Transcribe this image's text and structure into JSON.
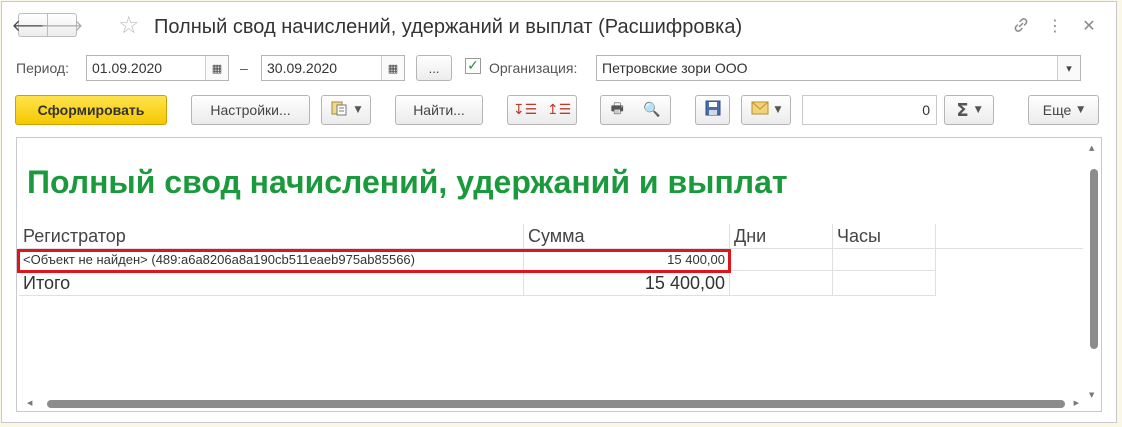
{
  "window": {
    "title": "Полный свод начислений, удержаний и выплат (Расшифровка)",
    "icons": {
      "back": "arrow-left-icon",
      "forward": "arrow-right-icon",
      "favorite": "star-icon",
      "link": "link-icon",
      "more": "more-vertical-icon",
      "close": "close-icon"
    }
  },
  "params": {
    "period_label": "Период:",
    "date_from": "01.09.2020",
    "dash": "–",
    "date_to": "30.09.2020",
    "choose_period_label": "...",
    "org_checked": true,
    "org_label": "Организация:",
    "org_value": "Петровские зори ООО"
  },
  "toolbar": {
    "generate_label": "Сформировать",
    "settings_label": "Настройки...",
    "find_label": "Найти...",
    "number_value": "0",
    "more_label": "Еще"
  },
  "report": {
    "title": "Полный свод начислений, удержаний и выплат",
    "columns": [
      "Регистратор",
      "Сумма",
      "Дни",
      "Часы"
    ],
    "rows": [
      {
        "registrar": "<Объект не найден> (489:a6a8206a8a190cb511eaeb975ab85566)",
        "sum": "15 400,00",
        "days": "",
        "hours": ""
      }
    ],
    "total": {
      "label": "Итого",
      "sum": "15 400,00",
      "days": "",
      "hours": ""
    }
  },
  "colors": {
    "accent_green": "#1a9a3c",
    "primary_button": "#f5c800",
    "highlight": "#e0141b"
  }
}
